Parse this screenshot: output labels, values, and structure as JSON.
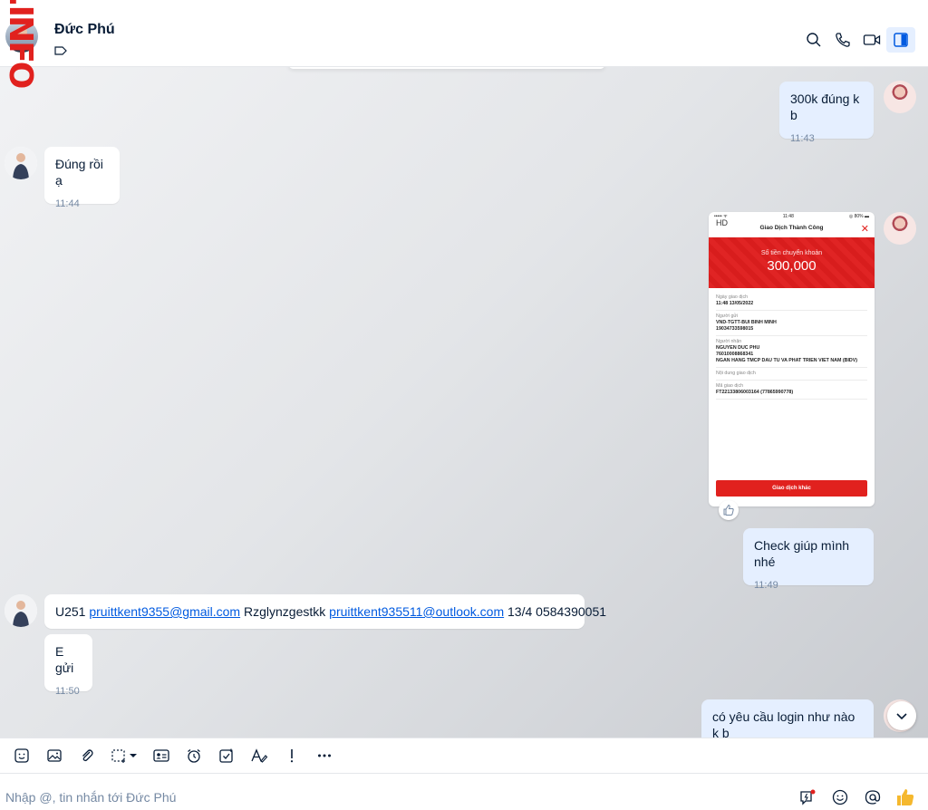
{
  "header": {
    "contact_name": "Đức Phú"
  },
  "watermark": ".INFO",
  "messages": [
    {
      "text": "300k đúng k b",
      "time": "11:43"
    },
    {
      "text": "Đúng rồi ạ",
      "time": "11:44"
    },
    {
      "text": "Check giúp mình nhé",
      "time": "11:49"
    },
    {
      "text_prefix": "U251 ",
      "email1": "pruittkent9355@gmail.com",
      "text_mid": " Rzglynzgestkk ",
      "email2": "pruittkent935511@outlook.com",
      "text_suffix": " 13/4 0584390051"
    },
    {
      "text": "E gửi",
      "time": "11:50"
    },
    {
      "text": "có yêu cầu login như nào k b"
    }
  ],
  "receipt": {
    "status_left": "••••• ᯤ",
    "status_time": "11:48",
    "status_right": "◎ 80% ▬",
    "hd": "HD",
    "title": "Giao Dịch Thành Công",
    "amount_label": "Số tiền chuyển khoản",
    "amount": "300,000",
    "rows": [
      {
        "k": "Ngày giao dịch",
        "v": "11:48 13/05/2022"
      },
      {
        "k": "Người gửi",
        "v": "VND-TGTT-BUI BINH MINH",
        "v2": "19034733598015"
      },
      {
        "k": "Người nhận",
        "v": "NGUYEN DUC PHU",
        "v2": "76010008868341",
        "v3": "NGAN HANG TMCP DAU TU VA PHAT TRIEN VIET NAM (BIDV)"
      },
      {
        "k": "Nội dung giao dịch",
        "v": ""
      },
      {
        "k": "Mã giao dịch",
        "v": "FT22133806003164 (77865990778)"
      }
    ],
    "button": "Giao dịch khác"
  },
  "composer": {
    "placeholder": "Nhập @, tin nhắn tới Đức Phú"
  },
  "icons": {
    "header": [
      "search-icon",
      "phone-icon",
      "video-icon",
      "sidebar-toggle-icon"
    ],
    "toolbar": [
      "sticker-icon",
      "image-icon",
      "attachment-icon",
      "screenshot-icon",
      "chevron-down-icon",
      "contact-card-icon",
      "reminder-icon",
      "task-icon",
      "text-format-icon",
      "priority-icon",
      "more-icon"
    ],
    "composer": [
      "quick-message-icon",
      "emoji-icon",
      "mention-icon",
      "thumbs-up-icon"
    ]
  },
  "colors": {
    "accent": "#005ae0",
    "my_bubble": "#e5efff",
    "their_bubble": "#ffffff",
    "receipt_red": "#e1211e",
    "like_yellow": "#f5b82e"
  }
}
